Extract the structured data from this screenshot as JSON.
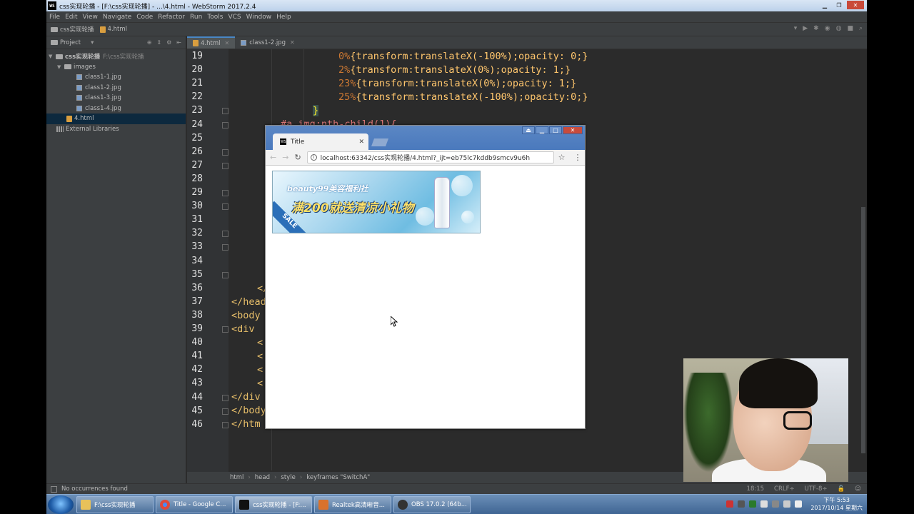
{
  "window": {
    "title": "css实现轮播 - [F:\\css实现轮播] - ...\\4.html - WebStorm 2017.2.4",
    "app_logo": "WS"
  },
  "menu": [
    "File",
    "Edit",
    "View",
    "Navigate",
    "Code",
    "Refactor",
    "Run",
    "Tools",
    "VCS",
    "Window",
    "Help"
  ],
  "navbar": {
    "project_crumb": "css实现轮播",
    "file_crumb": "4.html"
  },
  "project_panel": {
    "header": "Project",
    "tree": [
      {
        "label": "css实现轮播",
        "path": "F:\\css实现轮播",
        "type": "folder",
        "level": 0
      },
      {
        "label": "images",
        "type": "folder",
        "level": 1
      },
      {
        "label": "class1-1.jpg",
        "type": "image",
        "level": 2
      },
      {
        "label": "class1-2.jpg",
        "type": "image",
        "level": 2
      },
      {
        "label": "class1-3.jpg",
        "type": "image",
        "level": 2
      },
      {
        "label": "class1-4.jpg",
        "type": "image",
        "level": 2
      },
      {
        "label": "4.html",
        "type": "html",
        "level": 1,
        "selected": true
      },
      {
        "label": "External Libraries",
        "type": "lib",
        "level": 0
      }
    ]
  },
  "editor": {
    "tabs": [
      {
        "label": "4.html",
        "active": true
      },
      {
        "label": "class1-2.jpg",
        "active": false
      }
    ],
    "line_numbers": [
      "19",
      "20",
      "21",
      "22",
      "23",
      "24",
      "25",
      "26",
      "27",
      "28",
      "29",
      "30",
      "31",
      "32",
      "33",
      "34",
      "35",
      "36",
      "37",
      "38",
      "39",
      "40",
      "41",
      "42",
      "43",
      "44",
      "45",
      "46"
    ],
    "visible_code": [
      {
        "line": "19",
        "pct": "0%",
        "rest": "{transform:translateX(-100%);opacity: 0;}"
      },
      {
        "line": "20",
        "pct": "2%",
        "rest": "{transform:translateX(0%);opacity: 1;}"
      },
      {
        "line": "21",
        "pct": "23%",
        "rest": "{transform:translateX(0%);opacity: 1;}"
      },
      {
        "line": "22",
        "pct": "25%",
        "rest": "{transform:translateX(-100%);opacity:0;}"
      },
      {
        "line": "23",
        "text": "}"
      },
      {
        "line": "24",
        "text": "#a img:nth-child(1){"
      },
      {
        "line": "36",
        "text": "</"
      },
      {
        "line": "37",
        "text": "</head"
      },
      {
        "line": "38",
        "text": "<body"
      },
      {
        "line": "39",
        "text": "<div"
      },
      {
        "line": "40",
        "text": "<"
      },
      {
        "line": "41",
        "text": "<"
      },
      {
        "line": "42",
        "text": "<"
      },
      {
        "line": "43",
        "text": "<"
      },
      {
        "line": "44",
        "text": "</div"
      },
      {
        "line": "45",
        "text": "</body"
      },
      {
        "line": "46",
        "text": "</htm"
      }
    ]
  },
  "breadcrumb": [
    "html",
    "head",
    "style",
    "keyframes \"SwitchA\""
  ],
  "status": {
    "message": "No occurrences found",
    "position": "18:15",
    "line_sep": "CRLF÷",
    "encoding": "UTF-8÷"
  },
  "browser": {
    "tab_title": "Title",
    "url": "localhost:63342/css实现轮播/4.html?_ijt=eb75lc7kddb9smcv9u6h",
    "banner": {
      "subtitle": "beauty99美容福利社",
      "headline": "满200就送清凉小礼物",
      "sale": "SALE"
    }
  },
  "taskbar": {
    "items": [
      {
        "label": "F:\\css实现轮播",
        "color": "#e8c15a"
      },
      {
        "label": "Title - Google C...",
        "color": "#e0493b"
      },
      {
        "label": "css实现轮播 - [F:...",
        "color": "#111111"
      },
      {
        "label": "Realtek高清晰音...",
        "color": "#d9722c"
      },
      {
        "label": "OBS 17.0.2 (64b...",
        "color": "#333333"
      }
    ],
    "clock_time": "下午 5:53",
    "clock_date": "2017/10/14 星期六"
  }
}
